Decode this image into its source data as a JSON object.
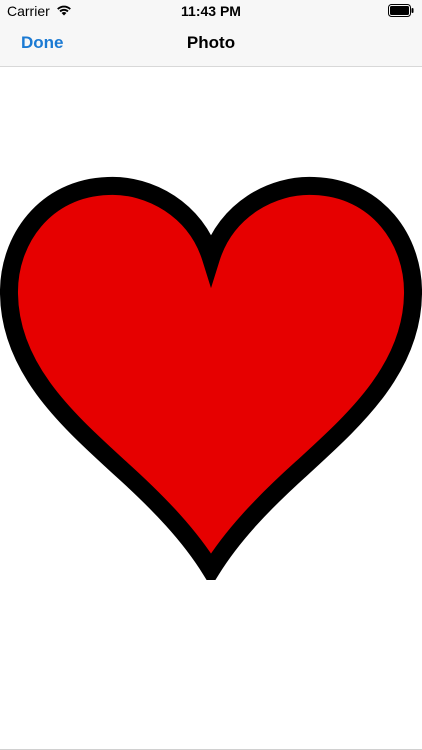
{
  "status_bar": {
    "carrier": "Carrier",
    "time": "11:43 PM"
  },
  "nav": {
    "done_label": "Done",
    "title": "Photo"
  },
  "photo": {
    "heart_fill": "#e60000",
    "heart_stroke": "#000000"
  },
  "colors": {
    "accent": "#1b7ad3",
    "bar_background": "#f7f7f7"
  }
}
